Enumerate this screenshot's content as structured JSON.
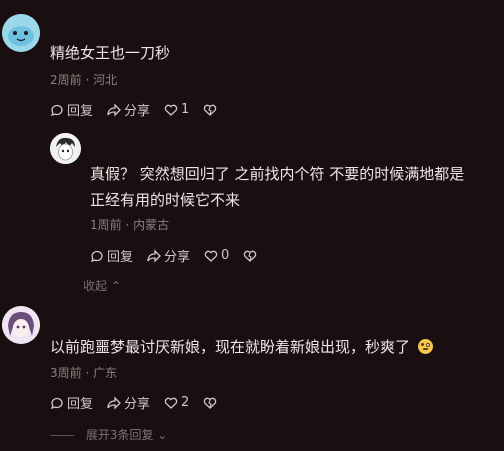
{
  "comments": [
    {
      "text": "精绝女王也一刀秒",
      "time": "2周前",
      "location": "河北",
      "reply_label": "回复",
      "share_label": "分享",
      "likes": "1"
    },
    {
      "text_line1": "真假？ 突然想回归了 之前找内个符 不要的时候满地都是",
      "text_line2": "正经有用的时候它不来",
      "time": "1周前",
      "location": "内蒙古",
      "reply_label": "回复",
      "share_label": "分享",
      "likes": "0"
    },
    {
      "text": "以前跑噩梦最讨厌新娘，现在就盼着新娘出现，秒爽了",
      "time": "3周前",
      "location": "广东",
      "reply_label": "回复",
      "share_label": "分享",
      "likes": "2"
    }
  ],
  "collapse_label": "收起",
  "expand_label": "展开3条回复",
  "colors": {
    "background": "#1a0f10",
    "text": "#ece7e7",
    "meta": "#8a8081"
  }
}
